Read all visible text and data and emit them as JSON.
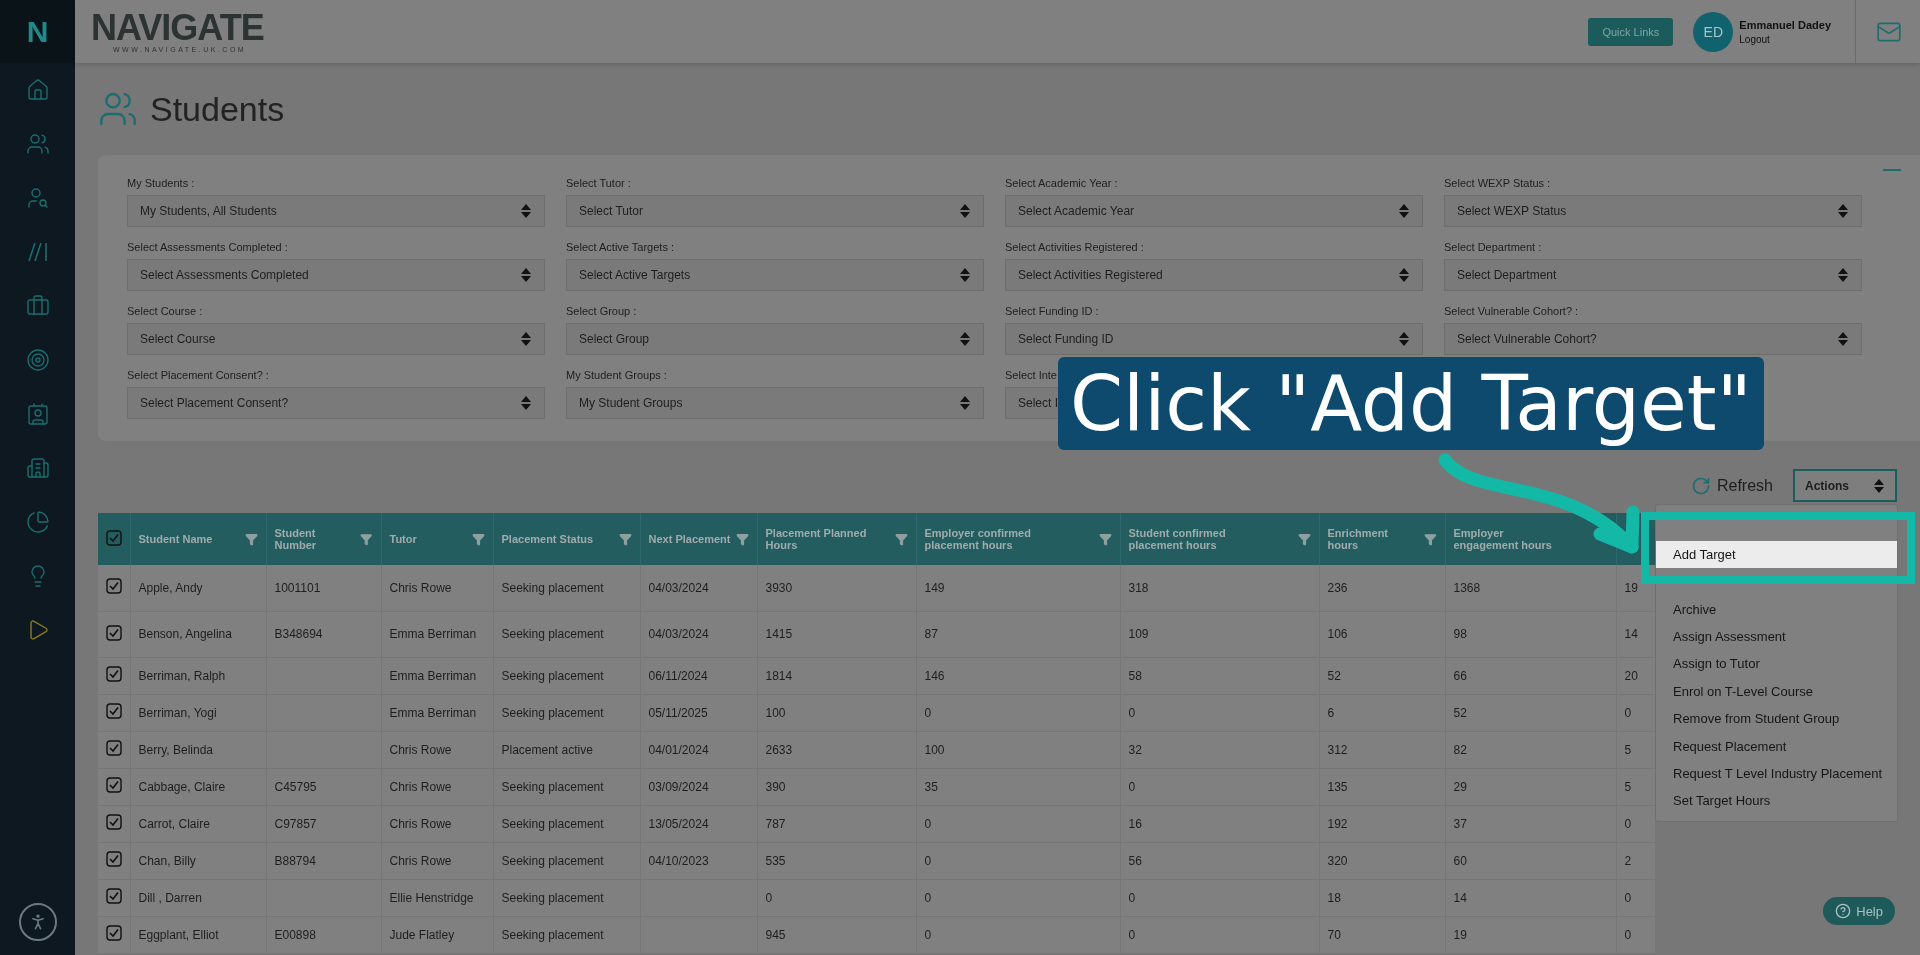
{
  "topbar": {
    "logo": "NAVIGATE",
    "logo_subtitle": "WWW.NAVIGATE.UK.COM",
    "quick_links": "Quick Links",
    "user": {
      "initials": "ED",
      "name": "Emmanuel Dadey",
      "logout": "Logout"
    }
  },
  "sidebar": {
    "logo": "N"
  },
  "page_title": "Students",
  "filters": [
    {
      "label": "My Students :",
      "value": "My Students, All Students"
    },
    {
      "label": "Select Tutor :",
      "value": "Select Tutor"
    },
    {
      "label": "Select Academic Year :",
      "value": "Select Academic Year"
    },
    {
      "label": "Select WEXP Status :",
      "value": "Select WEXP Status"
    },
    {
      "label": "Select Assessments Completed :",
      "value": "Select Assessments Completed"
    },
    {
      "label": "Select Active Targets :",
      "value": "Select Active Targets"
    },
    {
      "label": "Select Activities Registered :",
      "value": "Select Activities Registered"
    },
    {
      "label": "Select Department :",
      "value": "Select Department"
    },
    {
      "label": "Select Course :",
      "value": "Select Course"
    },
    {
      "label": "Select Group :",
      "value": "Select Group"
    },
    {
      "label": "Select Funding ID :",
      "value": "Select Funding ID"
    },
    {
      "label": "Select Vulnerable Cohort? :",
      "value": "Select Vulnerable Cohort?"
    },
    {
      "label": "Select Placement Consent? :",
      "value": "Select Placement Consent?"
    },
    {
      "label": "My Student Groups :",
      "value": "My Student Groups"
    },
    {
      "label": "Select Inte",
      "value": "Select I",
      "covered": true
    }
  ],
  "toolbar": {
    "refresh": "Refresh",
    "actions": "Actions"
  },
  "table": {
    "all_checked": true,
    "columns": [
      {
        "label": "Student Name",
        "filter": true
      },
      {
        "label": "Student Number",
        "filter": true
      },
      {
        "label": "Tutor",
        "filter": true
      },
      {
        "label": "Placement Status",
        "filter": true
      },
      {
        "label": "Next Placement",
        "filter": true
      },
      {
        "label": "Placement Planned Hours",
        "filter": true
      },
      {
        "label": "Employer confirmed placement hours",
        "filter": true
      },
      {
        "label": "Student confirmed placement hours",
        "filter": true
      },
      {
        "label": "Enrichment hours",
        "filter": true
      },
      {
        "label": "Employer engagement hours",
        "filter": false
      }
    ],
    "rows": [
      {
        "checked": true,
        "cells": [
          "Apple, Andy",
          "1001101",
          "Chris Rowe",
          "Seeking placement",
          "04/03/2024",
          "3930",
          "149",
          "318",
          "236",
          "1368",
          "19"
        ]
      },
      {
        "checked": true,
        "cells": [
          "Benson, Angelina",
          "B348694",
          "Emma Berriman",
          "Seeking placement",
          "04/03/2024",
          "1415",
          "87",
          "109",
          "106",
          "98",
          "14"
        ]
      },
      {
        "checked": true,
        "cells": [
          "Berriman, Ralph",
          null,
          "Emma Berriman",
          "Seeking placement",
          "06/11/2024",
          "1814",
          "146",
          "58",
          "52",
          "66",
          "20"
        ]
      },
      {
        "checked": true,
        "cells": [
          "Berriman, Yogi",
          null,
          "Emma Berriman",
          "Seeking placement",
          "05/11/2025",
          "100",
          "0",
          "0",
          "6",
          "52",
          "0"
        ]
      },
      {
        "checked": true,
        "cells": [
          "Berry, Belinda",
          null,
          "Chris Rowe",
          "Placement active",
          "04/01/2024",
          "2633",
          "100",
          "32",
          "312",
          "82",
          "5"
        ]
      },
      {
        "checked": true,
        "cells": [
          "Cabbage, Claire",
          "C45795",
          "Chris Rowe",
          "Seeking placement",
          "03/09/2024",
          "390",
          "35",
          "0",
          "135",
          "29",
          "5"
        ]
      },
      {
        "checked": true,
        "cells": [
          "Carrot, Claire",
          "C97857",
          "Chris Rowe",
          "Seeking placement",
          "13/05/2024",
          "787",
          "0",
          "16",
          "192",
          "37",
          "0"
        ]
      },
      {
        "checked": true,
        "cells": [
          "Chan, Billy",
          "B88794",
          "Chris Rowe",
          "Seeking placement",
          "04/10/2023",
          "535",
          "0",
          "56",
          "320",
          "60",
          "2"
        ]
      },
      {
        "checked": true,
        "cells": [
          "Dill , Darren",
          null,
          "Ellie Henstridge",
          "Seeking placement",
          null,
          "0",
          "0",
          "0",
          "18",
          "14",
          "0"
        ]
      },
      {
        "checked": true,
        "cells": [
          "Eggplant, Elliot",
          "E00898",
          "Jude Flatley",
          "Seeking placement",
          null,
          "945",
          "0",
          "0",
          "70",
          "19",
          "0"
        ]
      }
    ]
  },
  "actions_menu": [
    {
      "label": "Add Target",
      "selected": true
    },
    {
      "label": "Archive",
      "selected": false
    },
    {
      "label": "Assign Assessment",
      "selected": false
    },
    {
      "label": "Assign to Tutor",
      "selected": false
    },
    {
      "label": "Enrol on T-Level Course",
      "selected": false
    },
    {
      "label": "Remove from Student Group",
      "selected": false
    },
    {
      "label": "Request Placement",
      "selected": false
    },
    {
      "label": "Request T Level Industry Placement",
      "selected": false
    },
    {
      "label": "Set Target Hours",
      "selected": false
    }
  ],
  "callout": "Click \"Add Target\"",
  "help": "Help"
}
